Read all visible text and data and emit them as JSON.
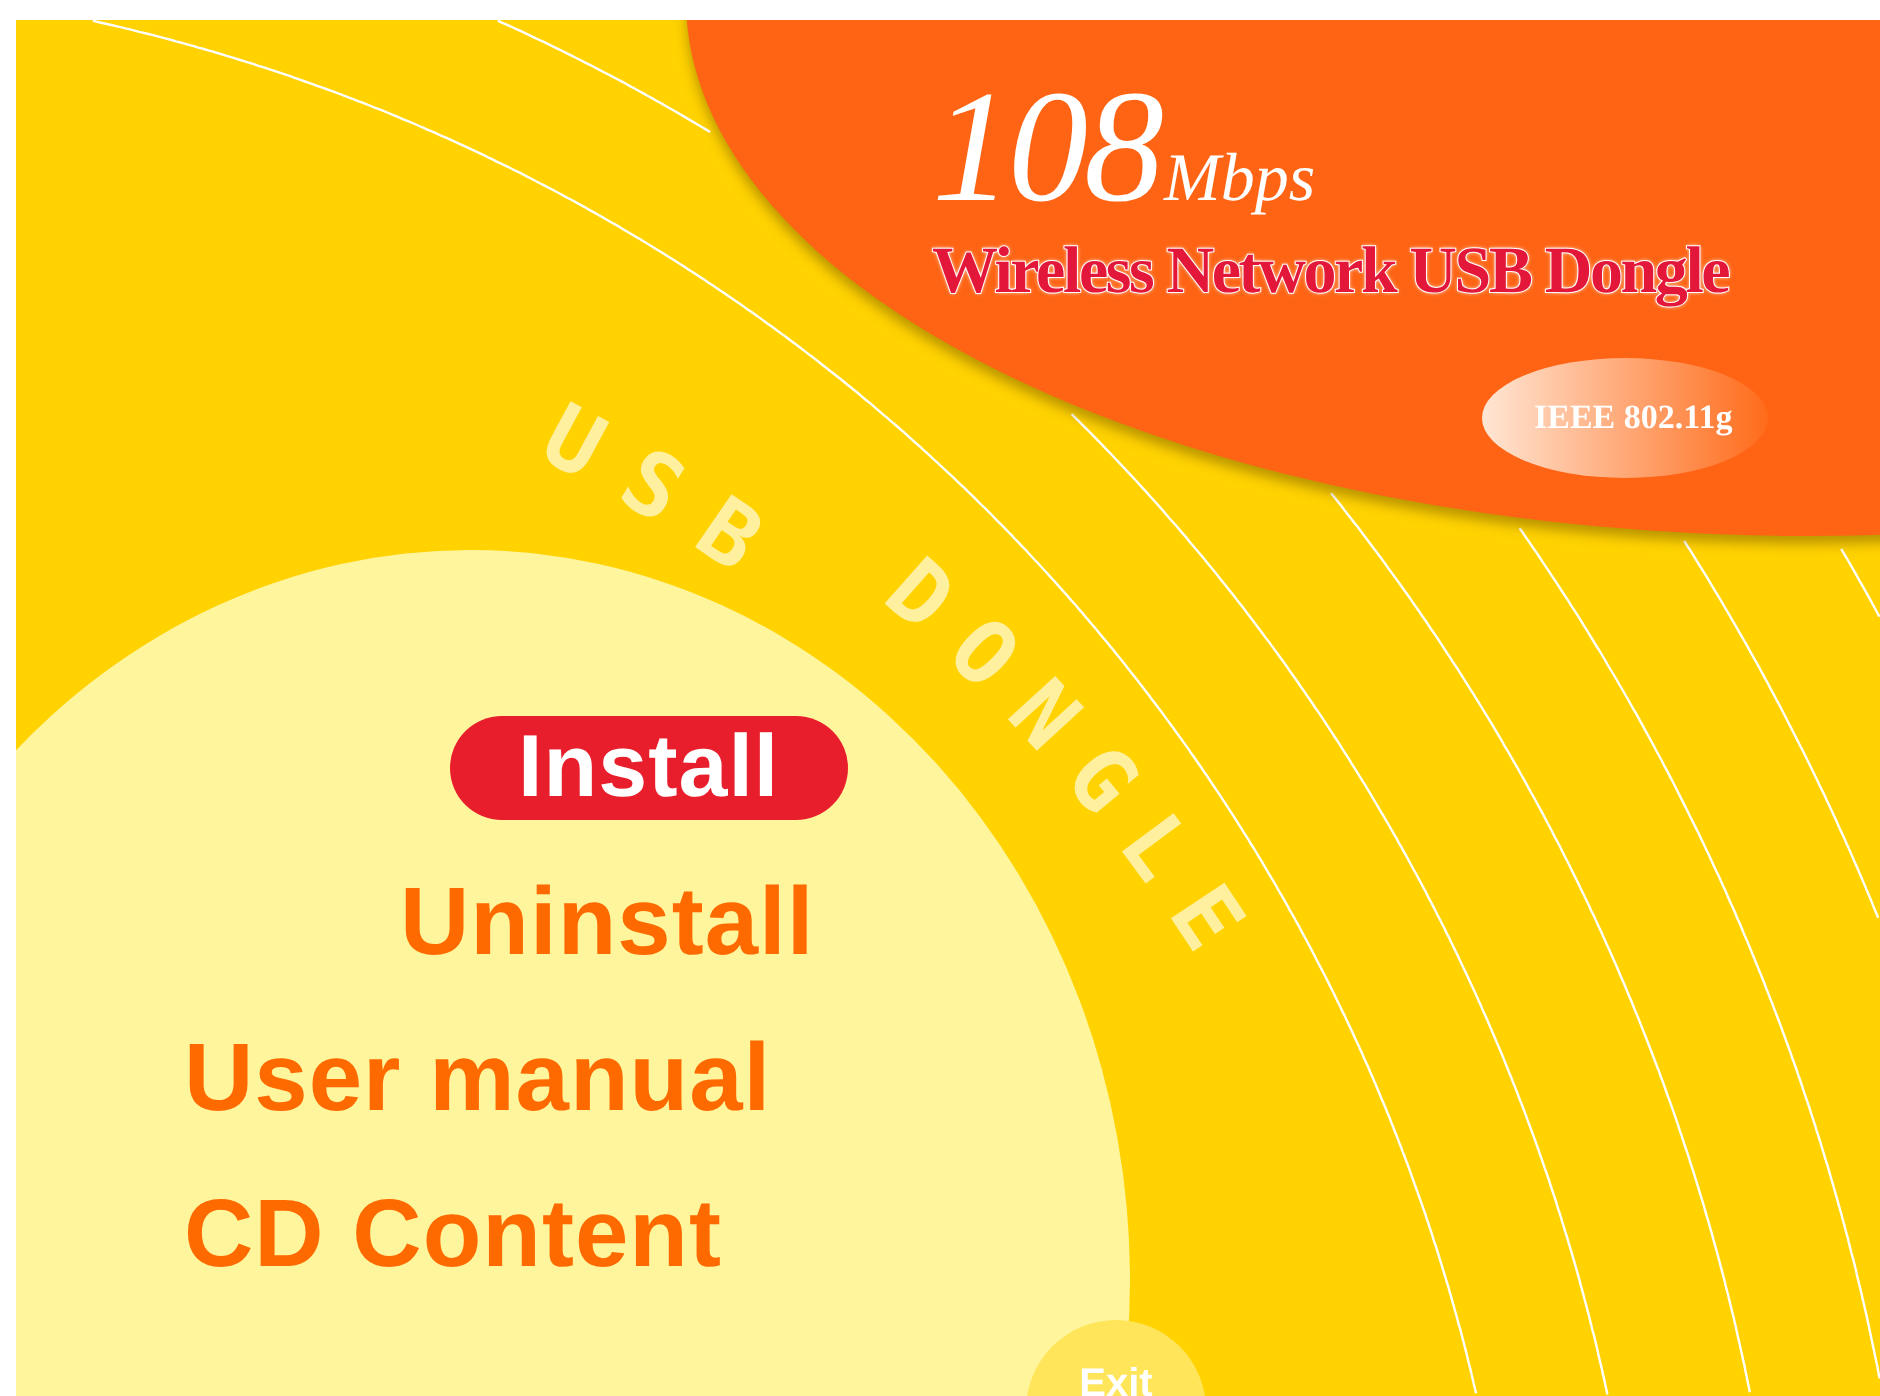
{
  "header": {
    "speed": "108",
    "unit": "Mbps",
    "product": "Wireless Network USB Dongle",
    "standard": "IEEE 802.11g"
  },
  "arc_label": [
    "USB",
    "DONGLE"
  ],
  "menu": [
    {
      "label": "Install",
      "selected": true
    },
    {
      "label": "Uninstall",
      "selected": false
    },
    {
      "label": "User manual",
      "selected": false
    },
    {
      "label": "CD Content",
      "selected": false
    }
  ],
  "exit": "Exit"
}
